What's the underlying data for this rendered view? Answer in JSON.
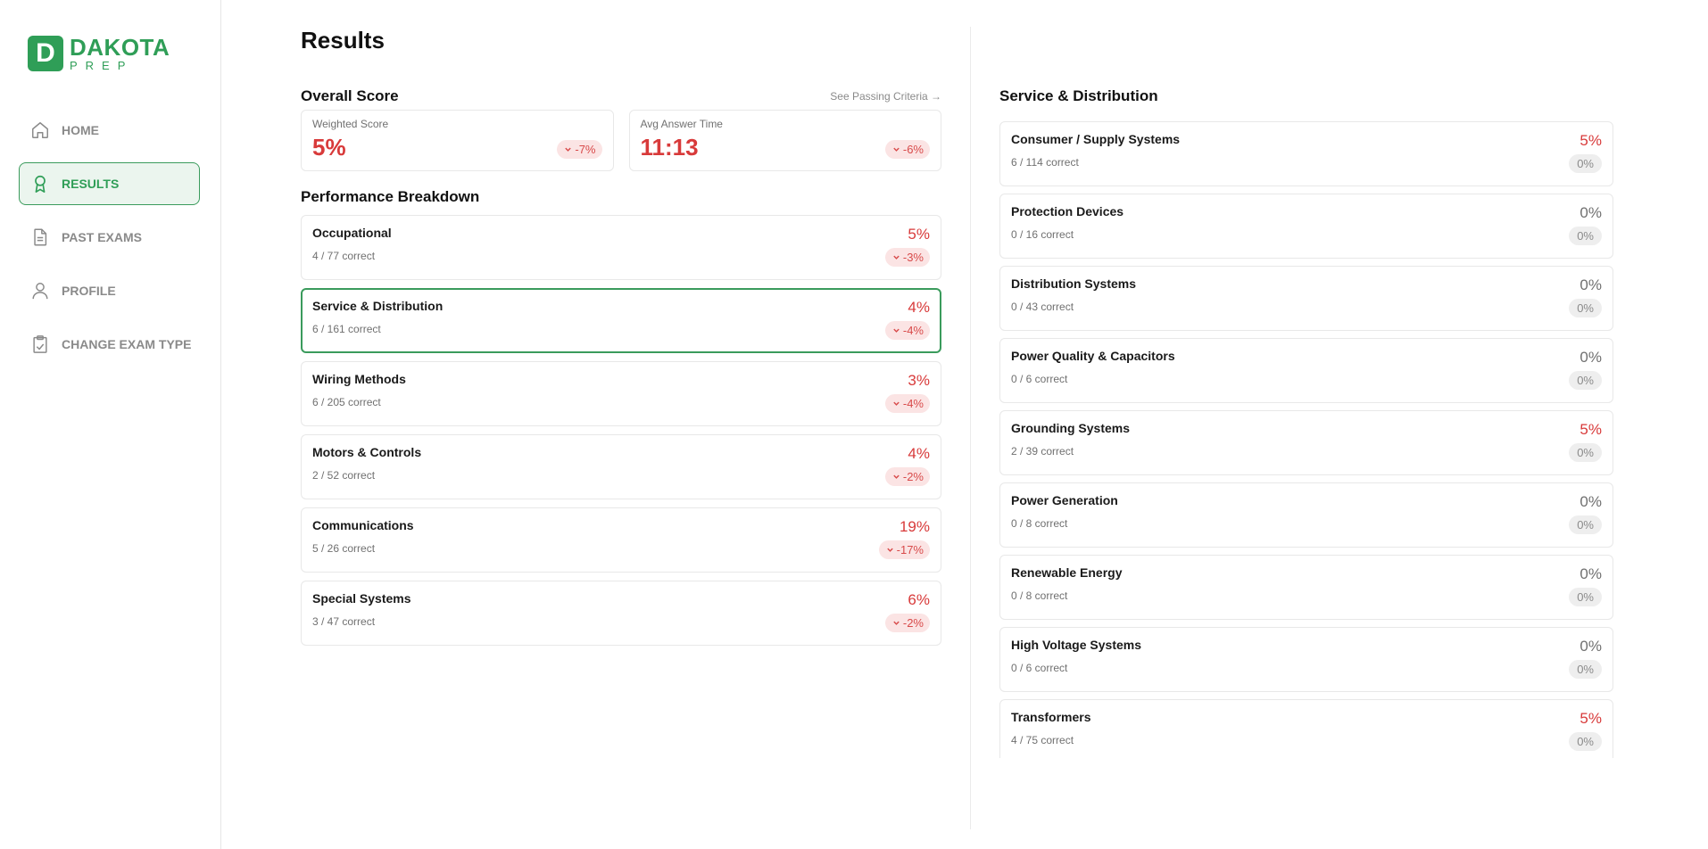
{
  "brand": {
    "mark": "D",
    "word": "DAKOTA",
    "sub": "PREP",
    "color": "#2f9e57"
  },
  "nav": [
    {
      "label": "HOME",
      "icon": "home-icon",
      "active": false
    },
    {
      "label": "RESULTS",
      "icon": "award-icon",
      "active": true
    },
    {
      "label": "PAST EXAMS",
      "icon": "document-icon",
      "active": false
    },
    {
      "label": "PROFILE",
      "icon": "user-icon",
      "active": false
    },
    {
      "label": "CHANGE EXAM TYPE",
      "icon": "clipboard-icon",
      "active": false
    }
  ],
  "page": {
    "title": "Results"
  },
  "overall": {
    "title": "Overall Score",
    "criteria_link": "See Passing Criteria →",
    "weighted": {
      "label": "Weighted Score",
      "value": "5%",
      "change": "-7%"
    },
    "time": {
      "label": "Avg Answer Time",
      "value": "11:13",
      "change": "-6%"
    }
  },
  "breakdown": {
    "title": "Performance Breakdown",
    "items": [
      {
        "name": "Occupational",
        "correct": "4 / 77 correct",
        "pct": "5%",
        "change": "-3%"
      },
      {
        "name": "Service & Distribution",
        "correct": "6 / 161 correct",
        "pct": "4%",
        "change": "-4%",
        "selected": true
      },
      {
        "name": "Wiring Methods",
        "correct": "6 / 205 correct",
        "pct": "3%",
        "change": "-4%"
      },
      {
        "name": "Motors & Controls",
        "correct": "2 / 52 correct",
        "pct": "4%",
        "change": "-2%"
      },
      {
        "name": "Communications",
        "correct": "5 / 26 correct",
        "pct": "19%",
        "change": "-17%"
      },
      {
        "name": "Special Systems",
        "correct": "3 / 47 correct",
        "pct": "6%",
        "change": "-2%"
      }
    ]
  },
  "detail": {
    "title": "Service & Distribution",
    "items": [
      {
        "name": "Consumer / Supply Systems",
        "correct": "6 / 114 correct",
        "pct": "5%",
        "change": "0%"
      },
      {
        "name": "Protection Devices",
        "correct": "0 / 16 correct",
        "pct": "0%",
        "change": "0%"
      },
      {
        "name": "Distribution Systems",
        "correct": "0 / 43 correct",
        "pct": "0%",
        "change": "0%"
      },
      {
        "name": "Power Quality & Capacitors",
        "correct": "0 / 6 correct",
        "pct": "0%",
        "change": "0%"
      },
      {
        "name": "Grounding Systems",
        "correct": "2 / 39 correct",
        "pct": "5%",
        "change": "0%"
      },
      {
        "name": "Power Generation",
        "correct": "0 / 8 correct",
        "pct": "0%",
        "change": "0%"
      },
      {
        "name": "Renewable Energy",
        "correct": "0 / 8 correct",
        "pct": "0%",
        "change": "0%"
      },
      {
        "name": "High Voltage Systems",
        "correct": "0 / 6 correct",
        "pct": "0%",
        "change": "0%"
      },
      {
        "name": "Transformers",
        "correct": "4 / 75 correct",
        "pct": "5%",
        "change": "0%"
      }
    ]
  },
  "colors": {
    "negative": "#d83a3a",
    "negative_bg": "#fbe4e4",
    "active_bg": "#ebf5ee",
    "active_border": "#3a9b5c"
  }
}
